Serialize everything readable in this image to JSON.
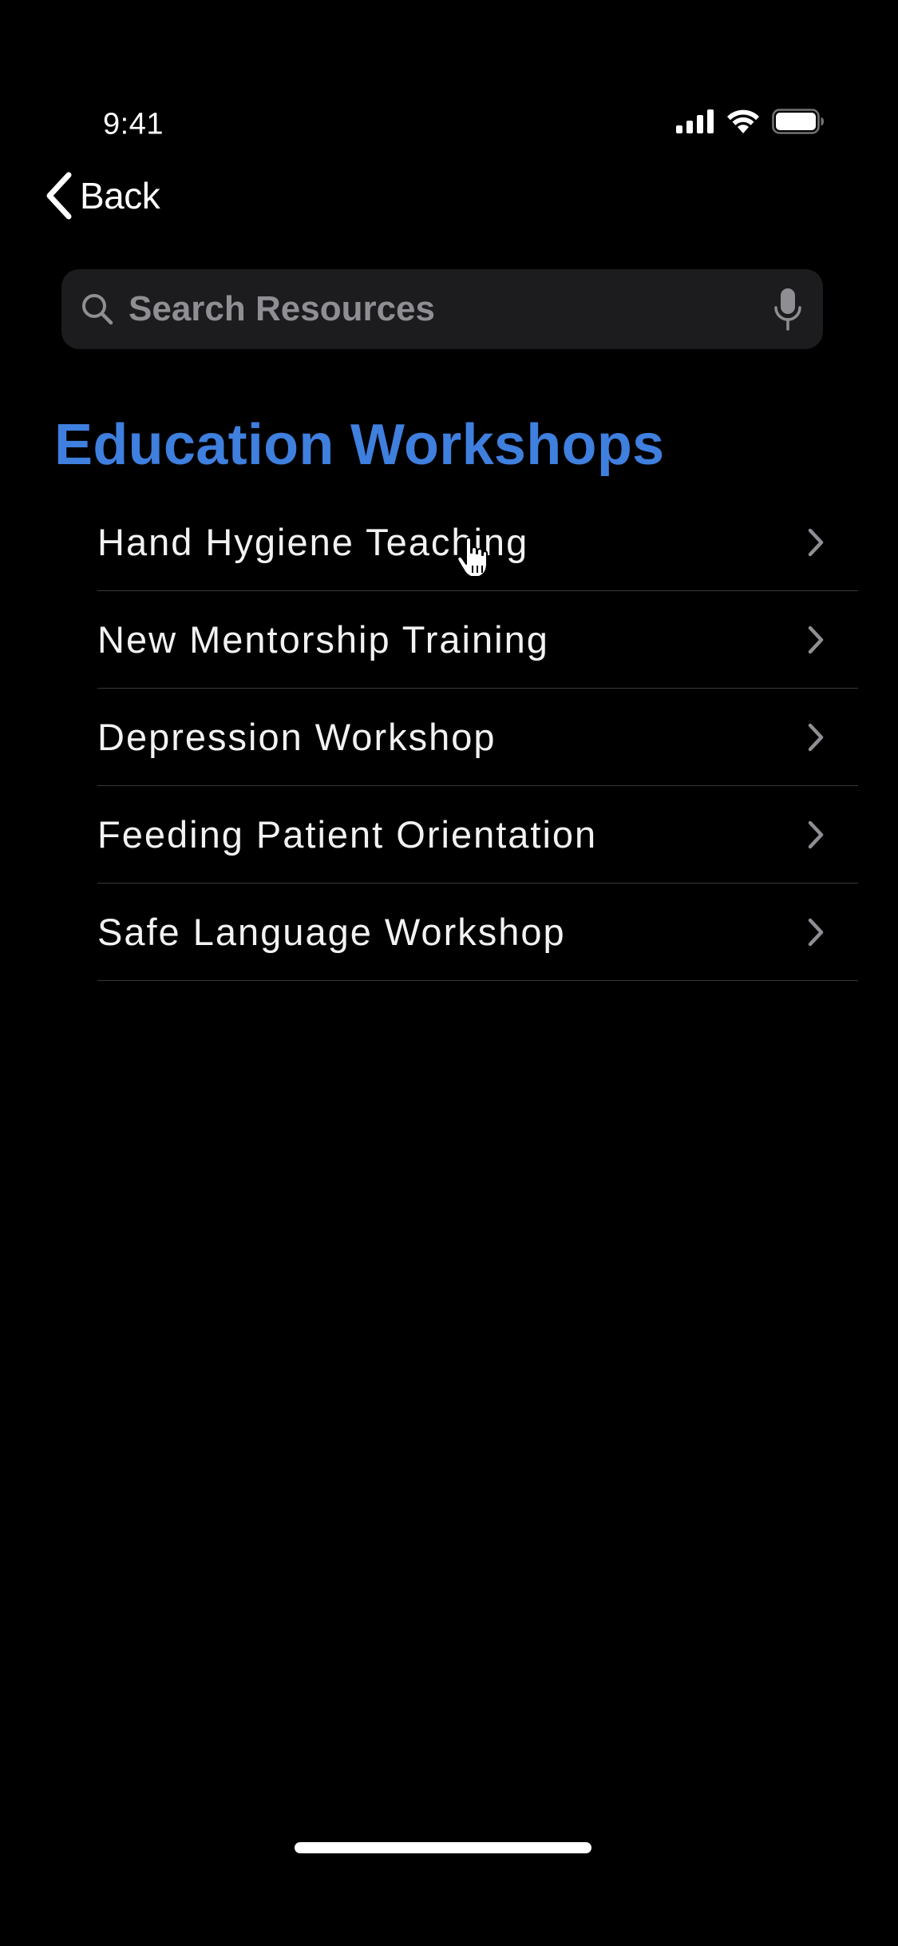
{
  "status_bar": {
    "time": "9:41",
    "signal_icon": "cellular-signal-icon",
    "wifi_icon": "wifi-icon",
    "battery_icon": "battery-icon"
  },
  "nav": {
    "back_label": "Back",
    "back_icon": "chevron-left-icon"
  },
  "search": {
    "placeholder": "Search Resources",
    "value": "",
    "search_icon": "search-icon",
    "mic_icon": "microphone-icon"
  },
  "section": {
    "title": "Education Workshops"
  },
  "workshops": [
    {
      "label": "Hand Hygiene Teaching"
    },
    {
      "label": "New Mentorship Training"
    },
    {
      "label": "Depression Workshop"
    },
    {
      "label": "Feeding Patient Orientation"
    },
    {
      "label": "Safe Language Workshop"
    }
  ],
  "colors": {
    "background": "#000000",
    "accent": "#3f7fde",
    "search_bg": "#1c1c1e",
    "placeholder": "#8e8e93",
    "separator": "#38383a",
    "chevron": "#8e8e93"
  }
}
